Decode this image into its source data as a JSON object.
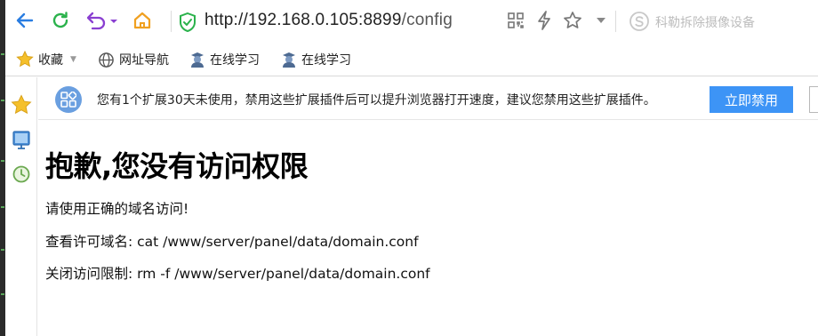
{
  "browser": {
    "url_host": "http://192.168.0.105:8899",
    "url_path": "/config",
    "search_placeholder": "科勒拆除摄像设备"
  },
  "bookmarks": {
    "favorites_label": "收藏",
    "items": [
      {
        "label": "网址导航"
      },
      {
        "label": "在线学习"
      },
      {
        "label": "在线学习"
      }
    ]
  },
  "notice": {
    "text": "您有1个扩展30天未使用，禁用这些扩展插件后可以提升浏览器打开速度，建议您禁用这些扩展插件。",
    "button_label": "立即禁用"
  },
  "page": {
    "heading": "抱歉,您没有访问权限",
    "line1": "请使用正确的域名访问!",
    "line2": "查看许可域名: cat /www/server/panel/data/domain.conf",
    "line3": "关闭访问限制: rm -f /www/server/panel/data/domain.conf"
  },
  "colors": {
    "accent_blue": "#3d94f6",
    "back_arrow": "#2a7de1",
    "reload_green": "#2bb24c",
    "undo_purple": "#8a3fd1",
    "home_orange": "#f0a020",
    "shield_green": "#2bb24c"
  },
  "icons": [
    "back-arrow-icon",
    "reload-icon",
    "undo-icon",
    "home-icon",
    "security-shield-icon",
    "qr-code-icon",
    "lightning-icon",
    "star-icon",
    "sogou-search-icon",
    "globe-icon",
    "student-avatar-icon",
    "extensions-icon",
    "monitor-icon",
    "history-clock-icon"
  ]
}
